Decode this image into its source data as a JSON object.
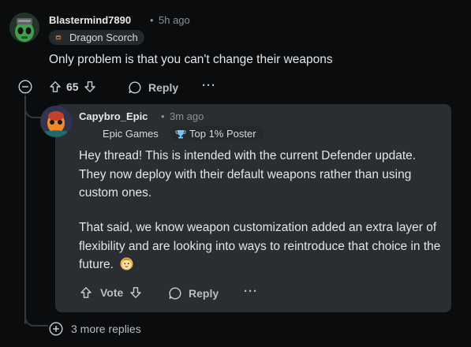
{
  "comment": {
    "username": "Blastermind7890",
    "time": "5h ago",
    "flair": "Dragon Scorch",
    "body": "Only problem is that you can't change their weapons",
    "score": "65",
    "reply_label": "Reply",
    "more_label": "···"
  },
  "reply": {
    "username": "Capybro_Epic",
    "time": "3m ago",
    "flair_org": "Epic Games",
    "flair_rank": "Top 1% Poster",
    "paragraph1": "Hey thread! This is intended with the current Defender update. They now deploy with their default weapons rather than using custom ones.",
    "paragraph2": "That said, we know weapon customization added an extra layer of flexibility and are looking into ways to reintroduce that choice in the future.",
    "vote_label": "Vote",
    "reply_label": "Reply",
    "more_label": "···"
  },
  "more_replies": {
    "label": "3 more replies"
  },
  "colors": {
    "background": "#0b0c0e",
    "card": "#2a2d31",
    "flair_bg": "#26292c",
    "thread_line": "#33383c",
    "muted_text": "#8a9297"
  }
}
